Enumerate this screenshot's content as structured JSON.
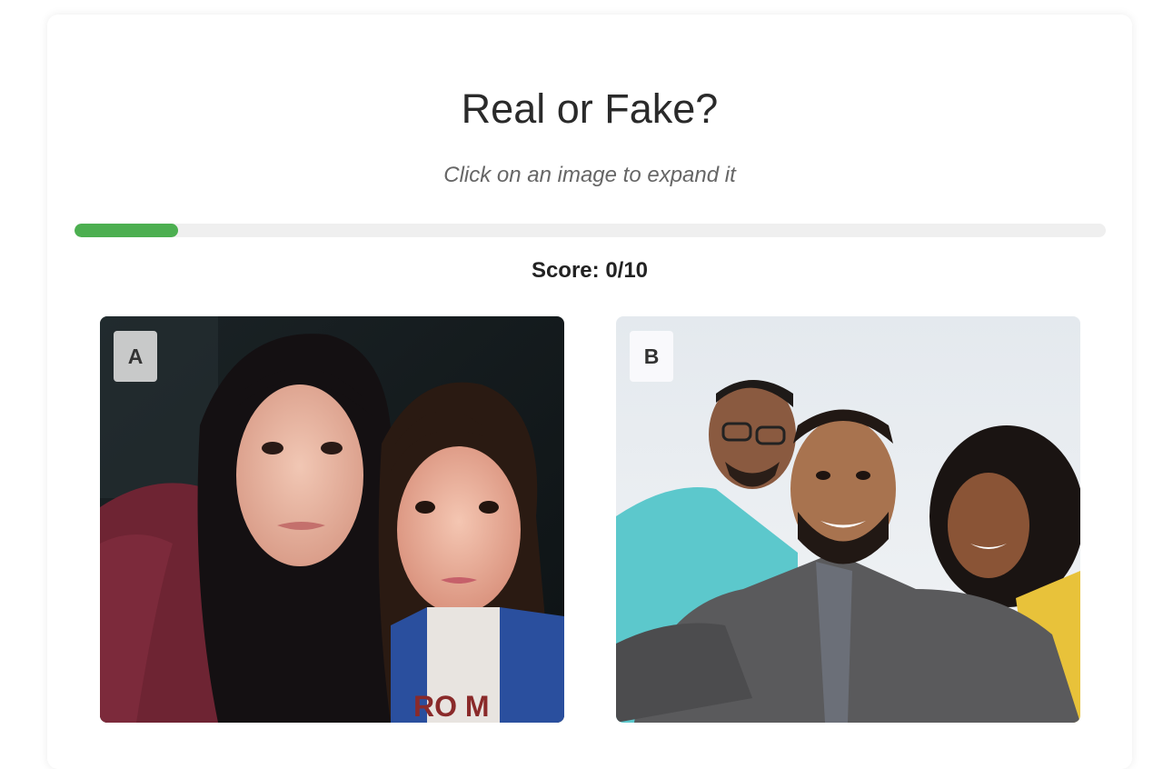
{
  "header": {
    "title": "Real or Fake?",
    "subtitle": "Click on an image to expand it"
  },
  "progress": {
    "fraction": 0.1,
    "color": "#4caf50"
  },
  "score": {
    "text": "Score: 0/10"
  },
  "images": [
    {
      "label": "A"
    },
    {
      "label": "B"
    }
  ]
}
